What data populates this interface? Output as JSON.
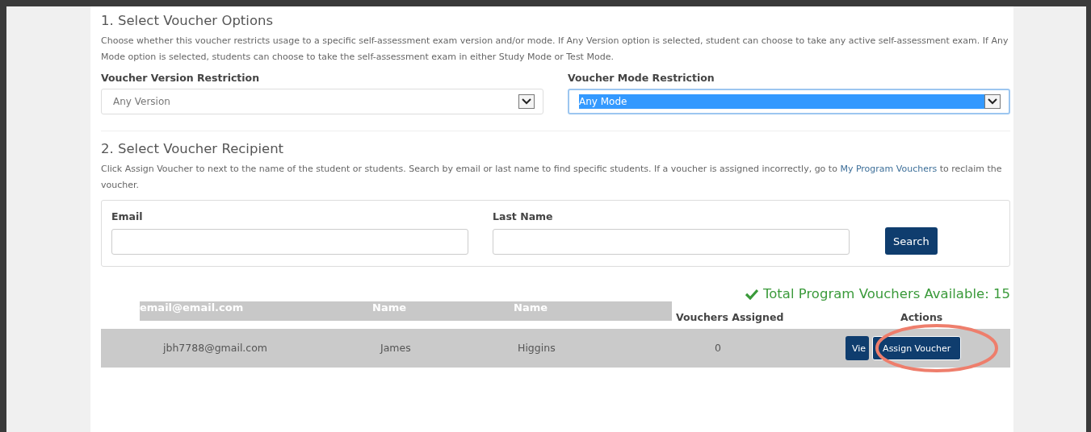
{
  "voucher_options": {
    "heading": "1. Select Voucher Options",
    "description": "Choose whether this voucher restricts usage to a specific self-assessment exam version and/or mode. If Any Version option is selected, student can choose to take any active self-assessment exam. If Any Mode option is selected, students can choose to take the self-assessment exam in either Study Mode or Test Mode.",
    "selects": [
      {
        "label": "Voucher Version Restriction",
        "value": "Any Version",
        "selected": false
      },
      {
        "label": "Voucher Mode Restriction",
        "value": "Any Mode",
        "selected": true
      }
    ]
  },
  "recipient": {
    "heading": "2. Select Voucher Recipient",
    "description": "Click Assign Voucher to next to the name of the student or students. Search by email or last name to find specific students. If a voucher is assigned incorrectly, go to ",
    "link": "My Program Vouchers",
    "description_end": " to reclaim the voucher.",
    "fields": [
      {
        "label": "Email"
      },
      {
        "label": "Last Name"
      }
    ],
    "search_button": "Search"
  },
  "total": "Total Program Vouchers Available: 15",
  "overlay": [
    "email@email.com",
    "Name",
    "Name"
  ],
  "table": {
    "columns": [
      "Vouchers Assigned",
      "Actions"
    ],
    "rows": [
      {
        "email": "jbh7788@gmail.com",
        "first_name": "James",
        "last_name": "Higgins",
        "assigned": "0",
        "buttons": [
          "Vie",
          "Assign Voucher"
        ],
        "highlighted": true
      }
    ]
  }
}
